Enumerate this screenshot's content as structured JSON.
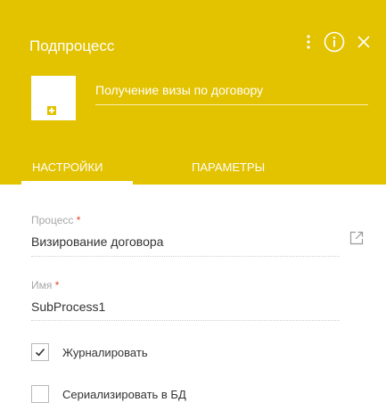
{
  "header": {
    "title": "Подпроцесс",
    "element_name": "Получение визы по договору",
    "icons": [
      "more-vertical-icon",
      "info-icon",
      "close-icon"
    ],
    "accent_color": "#e3c200"
  },
  "tabs": [
    {
      "label": "НАСТРОЙКИ",
      "active": true
    },
    {
      "label": "ПАРАМЕТРЫ",
      "active": false
    }
  ],
  "fields": {
    "process": {
      "label": "Процесс",
      "required_mark": "*",
      "value": "Визирование договора"
    },
    "name": {
      "label": "Имя",
      "required_mark": "*",
      "value": "SubProcess1"
    }
  },
  "checkboxes": [
    {
      "label": "Журналировать",
      "checked": true
    },
    {
      "label": "Сериализировать в БД",
      "checked": false
    }
  ]
}
